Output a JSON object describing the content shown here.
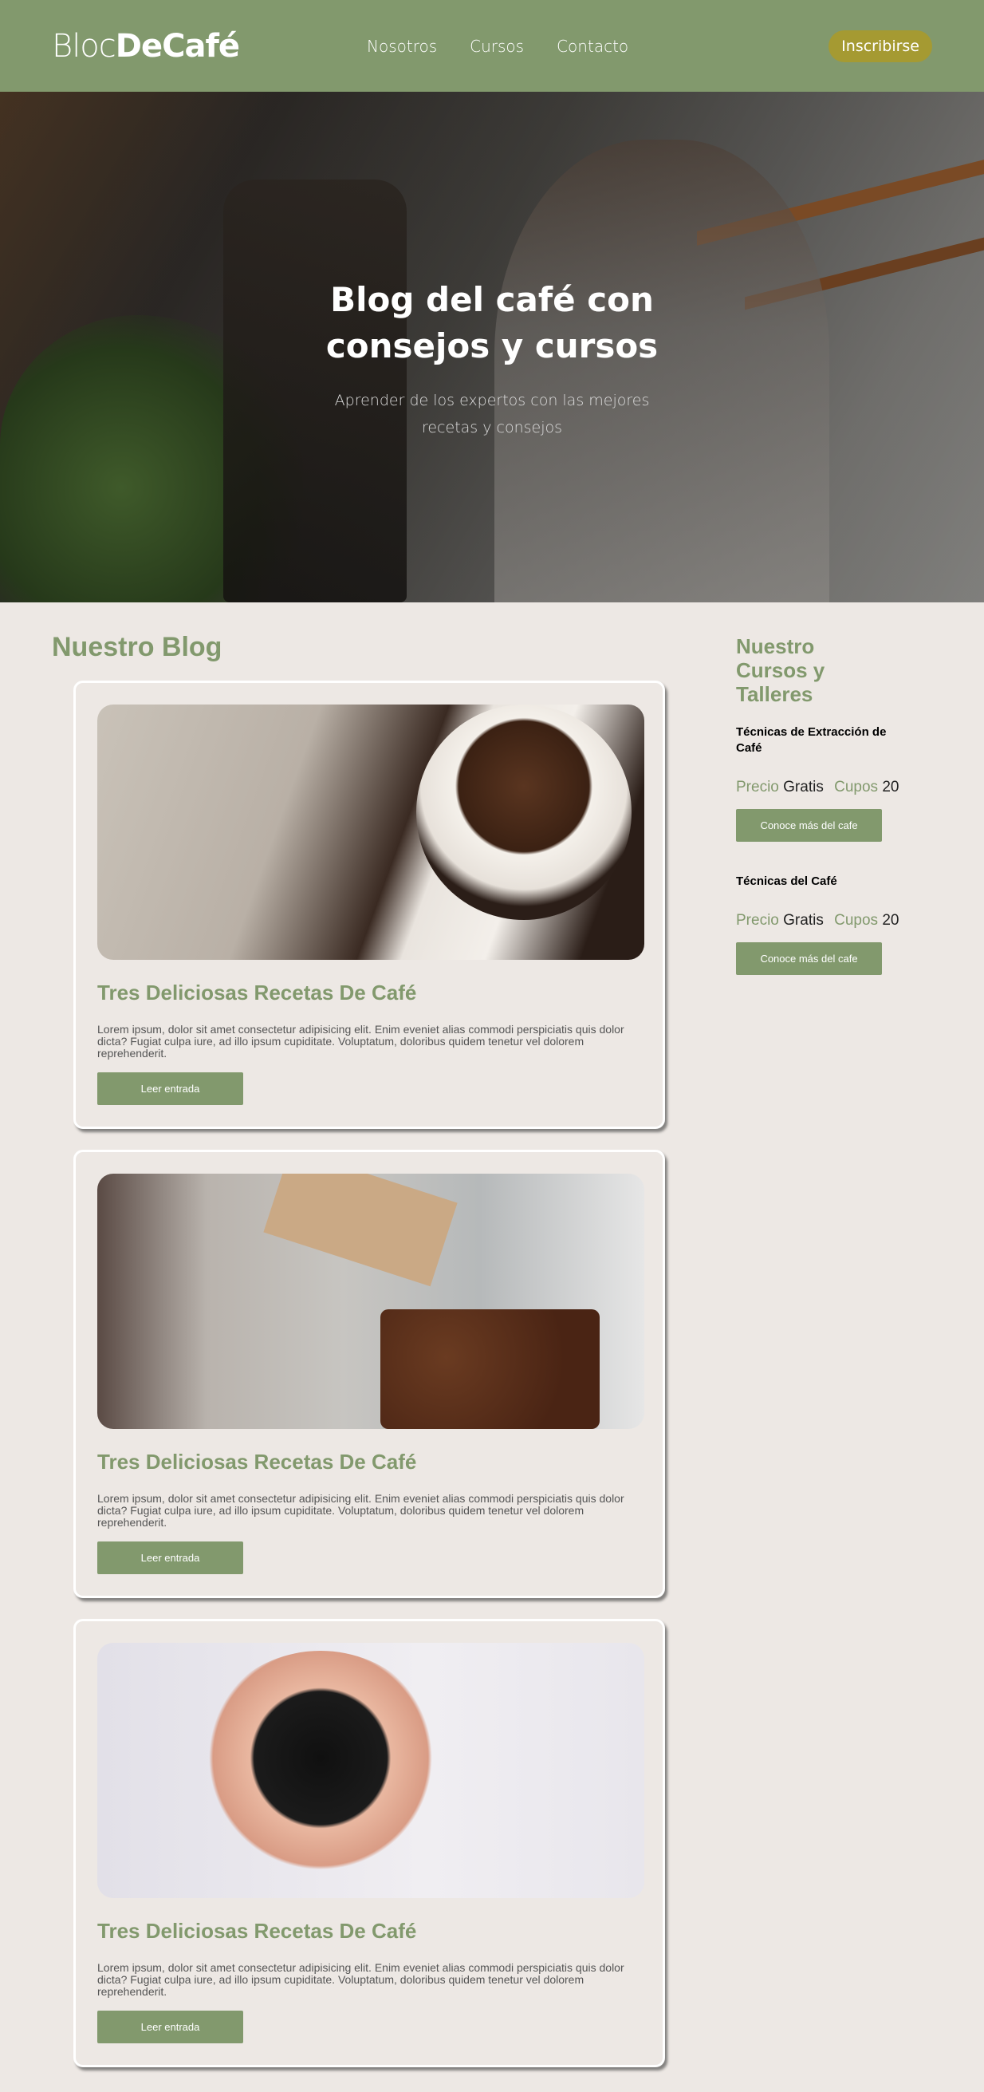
{
  "header": {
    "logo_light": "Bloc",
    "logo_bold": "DeCafé",
    "nav": [
      "Nosotros",
      "Cursos",
      "Contacto"
    ],
    "subscribe_label": "Inscribirse"
  },
  "hero": {
    "title": "Blog del café con consejos y cursos",
    "subtitle": "Aprender de los expertos con las mejores recetas y consejos"
  },
  "blog": {
    "title": "Nuestro Blog",
    "posts": [
      {
        "title": "Tres Deliciosas Recetas De Café",
        "text": "Lorem ipsum, dolor sit amet consectetur adipisicing elit. Enim eveniet alias commodi perspiciatis quis dolor dicta? Fugiat culpa iure, ad illo ipsum cupiditate. Voluptatum, doloribus quidem tenetur vel dolorem reprehenderit.",
        "button": "Leer entrada"
      },
      {
        "title": "Tres Deliciosas Recetas De Café",
        "text": "Lorem ipsum, dolor sit amet consectetur adipisicing elit. Enim eveniet alias commodi perspiciatis quis dolor dicta? Fugiat culpa iure, ad illo ipsum cupiditate. Voluptatum, doloribus quidem tenetur vel dolorem reprehenderit.",
        "button": "Leer entrada"
      },
      {
        "title": "Tres Deliciosas Recetas De Café",
        "text": "Lorem ipsum, dolor sit amet consectetur adipisicing elit. Enim eveniet alias commodi perspiciatis quis dolor dicta? Fugiat culpa iure, ad illo ipsum cupiditate. Voluptatum, doloribus quidem tenetur vel dolorem reprehenderit.",
        "button": "Leer entrada"
      }
    ]
  },
  "courses": {
    "title": "Nuestro Cursos y Talleres",
    "price_label": "Precio",
    "seats_label": "Cupos",
    "items": [
      {
        "name": "Técnicas de Extracción de Café",
        "price": "Gratis",
        "seats": "20",
        "button": "Conoce más del cafe"
      },
      {
        "name": "Técnicas del Café",
        "price": "Gratis",
        "seats": "20",
        "button": "Conoce más del cafe"
      }
    ]
  },
  "colors": {
    "brand_green": "#82996d",
    "accent_gold": "#a59a32",
    "background": "#ede8e4"
  }
}
